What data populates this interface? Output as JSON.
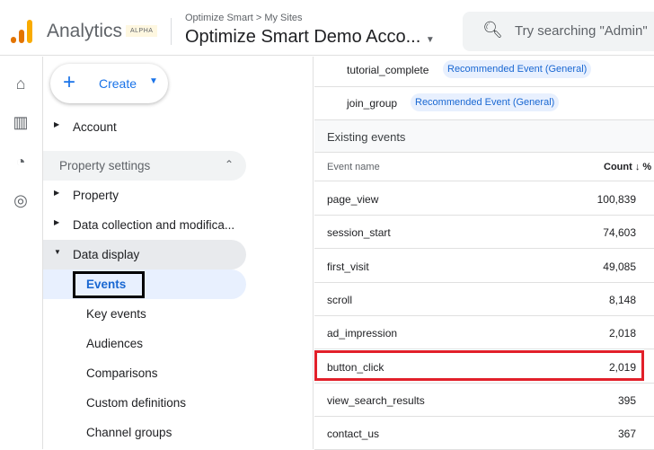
{
  "header": {
    "brand": "Analytics",
    "badge": "ALPHA",
    "breadcrumb": "Optimize Smart > My Sites",
    "account": "Optimize Smart Demo Acco...",
    "search_placeholder": "Try searching \"Admin\""
  },
  "create": {
    "label": "Create"
  },
  "nav": {
    "account": "Account",
    "property_settings": "Property settings",
    "property": "Property",
    "data_collection": "Data collection and modifica...",
    "data_display": "Data display",
    "events": "Events",
    "key_events": "Key events",
    "audiences": "Audiences",
    "comparisons": "Comparisons",
    "custom_definitions": "Custom definitions",
    "channel_groups": "Channel groups"
  },
  "recommended": [
    {
      "name": "tutorial_complete",
      "tag": "Recommended Event (General)"
    },
    {
      "name": "join_group",
      "tag": "Recommended Event (General)"
    }
  ],
  "existing": {
    "title": "Existing events",
    "col_name": "Event name",
    "col_count": "Count ↓ %",
    "rows": [
      {
        "name": "page_view",
        "count": "100,839"
      },
      {
        "name": "session_start",
        "count": "74,603"
      },
      {
        "name": "first_visit",
        "count": "49,085"
      },
      {
        "name": "scroll",
        "count": "8,148"
      },
      {
        "name": "ad_impression",
        "count": "2,018"
      },
      {
        "name": "button_click",
        "count": "2,019"
      },
      {
        "name": "view_search_results",
        "count": "395"
      },
      {
        "name": "contact_us",
        "count": "367"
      }
    ]
  },
  "colors": {
    "accent": "#1a73e8",
    "highlight": "#e2202a"
  }
}
